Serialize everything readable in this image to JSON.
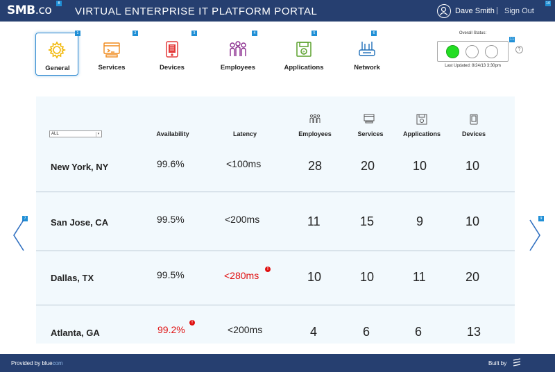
{
  "header": {
    "logo": "SMB",
    "logo_suffix": ".co",
    "title": "VIRTUAL ENTERPRISE IT PLATFORM PORTAL",
    "user_name": "Dave Smith",
    "separator": "|",
    "sign_out": "Sign Out"
  },
  "badges": {
    "logo": "8",
    "general": "1",
    "services": "2",
    "devices": "3",
    "employees": "4",
    "applications": "5",
    "network": "6",
    "left_arrow": "7",
    "right_arrow": "9",
    "status": "11",
    "signout": "10"
  },
  "nav": [
    {
      "label": "General",
      "icon": "gear-icon",
      "active": true
    },
    {
      "label": "Services",
      "icon": "services-icon"
    },
    {
      "label": "Devices",
      "icon": "tablet-icon"
    },
    {
      "label": "Employees",
      "icon": "people-icon"
    },
    {
      "label": "Applications",
      "icon": "disk-icon"
    },
    {
      "label": "Network",
      "icon": "router-icon"
    }
  ],
  "status": {
    "label": "Overall Status:",
    "updated": "Last Updated: 8/24/13  3:30pm",
    "help": "?",
    "green": "#22dd22"
  },
  "table": {
    "filter_value": "ALL",
    "columns": {
      "availability": "Availability",
      "latency": "Latency",
      "employees": "Employees",
      "services": "Services",
      "applications": "Applications",
      "devices": "Devices"
    },
    "rows": [
      {
        "city": "New York, NY",
        "availability": "99.6%",
        "latency": "<100ms",
        "employees": "28",
        "services": "20",
        "applications": "10",
        "devices": "10"
      },
      {
        "city": "San Jose, CA",
        "availability": "99.5%",
        "latency": "<200ms",
        "employees": "11",
        "services": "15",
        "applications": "9",
        "devices": "10"
      },
      {
        "city": "Dallas, TX",
        "availability": "99.5%",
        "latency": "<280ms",
        "employees": "10",
        "services": "10",
        "applications": "11",
        "devices": "20"
      },
      {
        "city": "Atlanta, GA",
        "availability": "99.2%",
        "latency": "<200ms",
        "employees": "4",
        "services": "6",
        "applications": "6",
        "devices": "13"
      }
    ],
    "alert_mark": "!",
    "alert_color": "#e01010"
  },
  "footer": {
    "provided_by": "Provided by ",
    "brand_a": "blue",
    "brand_b": "com",
    "built_by": "Built by"
  },
  "colors": {
    "header_bg": "#263f70",
    "accent": "#2f8ad0",
    "panel_bg": "#f2f9fd"
  }
}
